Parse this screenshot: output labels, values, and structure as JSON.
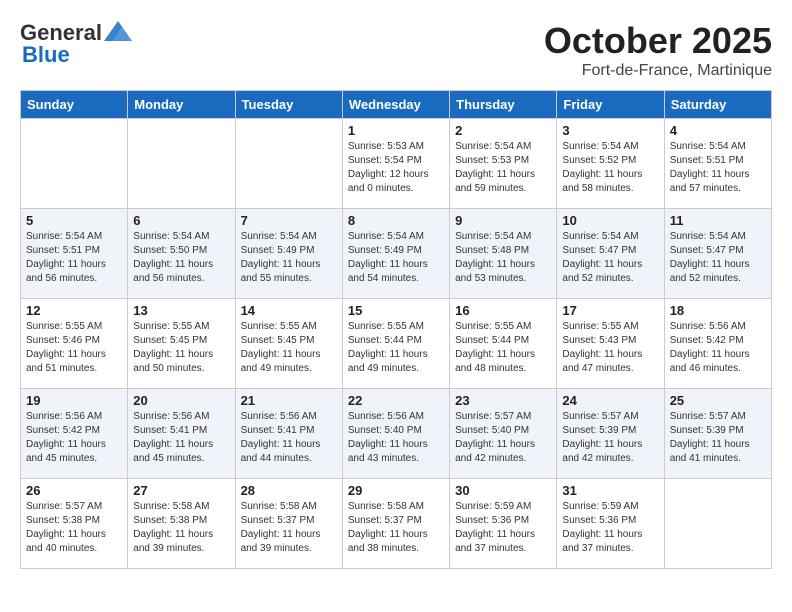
{
  "header": {
    "logo_general": "General",
    "logo_blue": "Blue",
    "month_title": "October 2025",
    "location": "Fort-de-France, Martinique"
  },
  "weekdays": [
    "Sunday",
    "Monday",
    "Tuesday",
    "Wednesday",
    "Thursday",
    "Friday",
    "Saturday"
  ],
  "weeks": [
    [
      {
        "day": "",
        "sunrise": "",
        "sunset": "",
        "daylight": "",
        "empty": true
      },
      {
        "day": "",
        "sunrise": "",
        "sunset": "",
        "daylight": "",
        "empty": true
      },
      {
        "day": "",
        "sunrise": "",
        "sunset": "",
        "daylight": "",
        "empty": true
      },
      {
        "day": "1",
        "sunrise": "Sunrise: 5:53 AM",
        "sunset": "Sunset: 5:54 PM",
        "daylight": "Daylight: 12 hours and 0 minutes."
      },
      {
        "day": "2",
        "sunrise": "Sunrise: 5:54 AM",
        "sunset": "Sunset: 5:53 PM",
        "daylight": "Daylight: 11 hours and 59 minutes."
      },
      {
        "day": "3",
        "sunrise": "Sunrise: 5:54 AM",
        "sunset": "Sunset: 5:52 PM",
        "daylight": "Daylight: 11 hours and 58 minutes."
      },
      {
        "day": "4",
        "sunrise": "Sunrise: 5:54 AM",
        "sunset": "Sunset: 5:51 PM",
        "daylight": "Daylight: 11 hours and 57 minutes."
      }
    ],
    [
      {
        "day": "5",
        "sunrise": "Sunrise: 5:54 AM",
        "sunset": "Sunset: 5:51 PM",
        "daylight": "Daylight: 11 hours and 56 minutes."
      },
      {
        "day": "6",
        "sunrise": "Sunrise: 5:54 AM",
        "sunset": "Sunset: 5:50 PM",
        "daylight": "Daylight: 11 hours and 56 minutes."
      },
      {
        "day": "7",
        "sunrise": "Sunrise: 5:54 AM",
        "sunset": "Sunset: 5:49 PM",
        "daylight": "Daylight: 11 hours and 55 minutes."
      },
      {
        "day": "8",
        "sunrise": "Sunrise: 5:54 AM",
        "sunset": "Sunset: 5:49 PM",
        "daylight": "Daylight: 11 hours and 54 minutes."
      },
      {
        "day": "9",
        "sunrise": "Sunrise: 5:54 AM",
        "sunset": "Sunset: 5:48 PM",
        "daylight": "Daylight: 11 hours and 53 minutes."
      },
      {
        "day": "10",
        "sunrise": "Sunrise: 5:54 AM",
        "sunset": "Sunset: 5:47 PM",
        "daylight": "Daylight: 11 hours and 52 minutes."
      },
      {
        "day": "11",
        "sunrise": "Sunrise: 5:54 AM",
        "sunset": "Sunset: 5:47 PM",
        "daylight": "Daylight: 11 hours and 52 minutes."
      }
    ],
    [
      {
        "day": "12",
        "sunrise": "Sunrise: 5:55 AM",
        "sunset": "Sunset: 5:46 PM",
        "daylight": "Daylight: 11 hours and 51 minutes."
      },
      {
        "day": "13",
        "sunrise": "Sunrise: 5:55 AM",
        "sunset": "Sunset: 5:45 PM",
        "daylight": "Daylight: 11 hours and 50 minutes."
      },
      {
        "day": "14",
        "sunrise": "Sunrise: 5:55 AM",
        "sunset": "Sunset: 5:45 PM",
        "daylight": "Daylight: 11 hours and 49 minutes."
      },
      {
        "day": "15",
        "sunrise": "Sunrise: 5:55 AM",
        "sunset": "Sunset: 5:44 PM",
        "daylight": "Daylight: 11 hours and 49 minutes."
      },
      {
        "day": "16",
        "sunrise": "Sunrise: 5:55 AM",
        "sunset": "Sunset: 5:44 PM",
        "daylight": "Daylight: 11 hours and 48 minutes."
      },
      {
        "day": "17",
        "sunrise": "Sunrise: 5:55 AM",
        "sunset": "Sunset: 5:43 PM",
        "daylight": "Daylight: 11 hours and 47 minutes."
      },
      {
        "day": "18",
        "sunrise": "Sunrise: 5:56 AM",
        "sunset": "Sunset: 5:42 PM",
        "daylight": "Daylight: 11 hours and 46 minutes."
      }
    ],
    [
      {
        "day": "19",
        "sunrise": "Sunrise: 5:56 AM",
        "sunset": "Sunset: 5:42 PM",
        "daylight": "Daylight: 11 hours and 45 minutes."
      },
      {
        "day": "20",
        "sunrise": "Sunrise: 5:56 AM",
        "sunset": "Sunset: 5:41 PM",
        "daylight": "Daylight: 11 hours and 45 minutes."
      },
      {
        "day": "21",
        "sunrise": "Sunrise: 5:56 AM",
        "sunset": "Sunset: 5:41 PM",
        "daylight": "Daylight: 11 hours and 44 minutes."
      },
      {
        "day": "22",
        "sunrise": "Sunrise: 5:56 AM",
        "sunset": "Sunset: 5:40 PM",
        "daylight": "Daylight: 11 hours and 43 minutes."
      },
      {
        "day": "23",
        "sunrise": "Sunrise: 5:57 AM",
        "sunset": "Sunset: 5:40 PM",
        "daylight": "Daylight: 11 hours and 42 minutes."
      },
      {
        "day": "24",
        "sunrise": "Sunrise: 5:57 AM",
        "sunset": "Sunset: 5:39 PM",
        "daylight": "Daylight: 11 hours and 42 minutes."
      },
      {
        "day": "25",
        "sunrise": "Sunrise: 5:57 AM",
        "sunset": "Sunset: 5:39 PM",
        "daylight": "Daylight: 11 hours and 41 minutes."
      }
    ],
    [
      {
        "day": "26",
        "sunrise": "Sunrise: 5:57 AM",
        "sunset": "Sunset: 5:38 PM",
        "daylight": "Daylight: 11 hours and 40 minutes."
      },
      {
        "day": "27",
        "sunrise": "Sunrise: 5:58 AM",
        "sunset": "Sunset: 5:38 PM",
        "daylight": "Daylight: 11 hours and 39 minutes."
      },
      {
        "day": "28",
        "sunrise": "Sunrise: 5:58 AM",
        "sunset": "Sunset: 5:37 PM",
        "daylight": "Daylight: 11 hours and 39 minutes."
      },
      {
        "day": "29",
        "sunrise": "Sunrise: 5:58 AM",
        "sunset": "Sunset: 5:37 PM",
        "daylight": "Daylight: 11 hours and 38 minutes."
      },
      {
        "day": "30",
        "sunrise": "Sunrise: 5:59 AM",
        "sunset": "Sunset: 5:36 PM",
        "daylight": "Daylight: 11 hours and 37 minutes."
      },
      {
        "day": "31",
        "sunrise": "Sunrise: 5:59 AM",
        "sunset": "Sunset: 5:36 PM",
        "daylight": "Daylight: 11 hours and 37 minutes."
      },
      {
        "day": "",
        "sunrise": "",
        "sunset": "",
        "daylight": "",
        "empty": true
      }
    ]
  ]
}
